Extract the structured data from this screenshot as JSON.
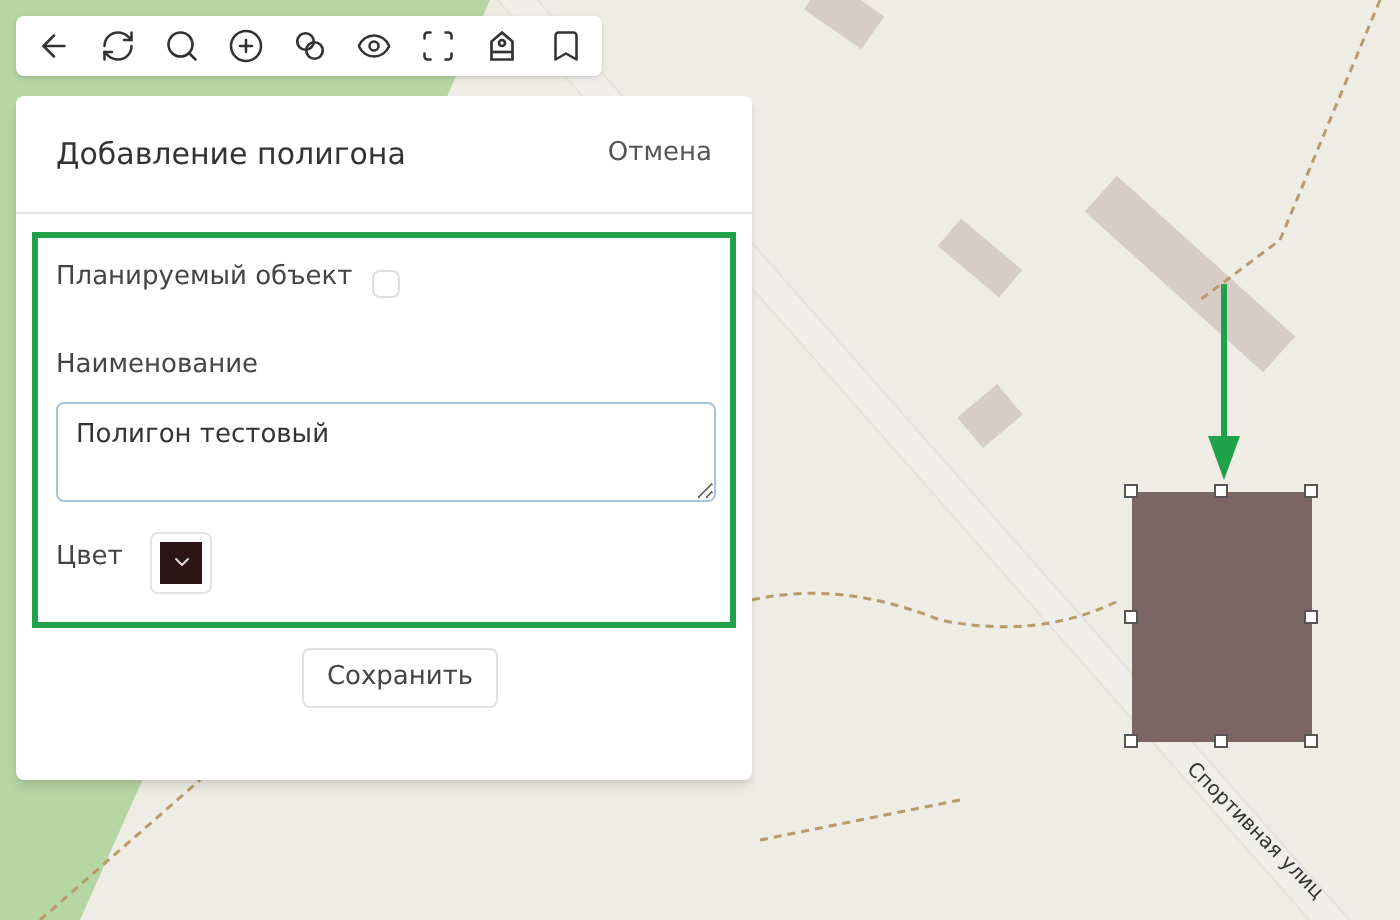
{
  "map": {
    "street_label": "Спортивная улиц"
  },
  "polygon": {
    "selected": true,
    "color": "#7b6663"
  },
  "panel": {
    "title": "Добавление полигона",
    "cancel": "Отмена",
    "planned": {
      "label": "Планируемый объект",
      "checked": false
    },
    "name": {
      "label": "Наименование",
      "value": "Полигон тестовый"
    },
    "color": {
      "label": "Цвет",
      "color": "#2b1517"
    },
    "save": "Сохранить"
  }
}
